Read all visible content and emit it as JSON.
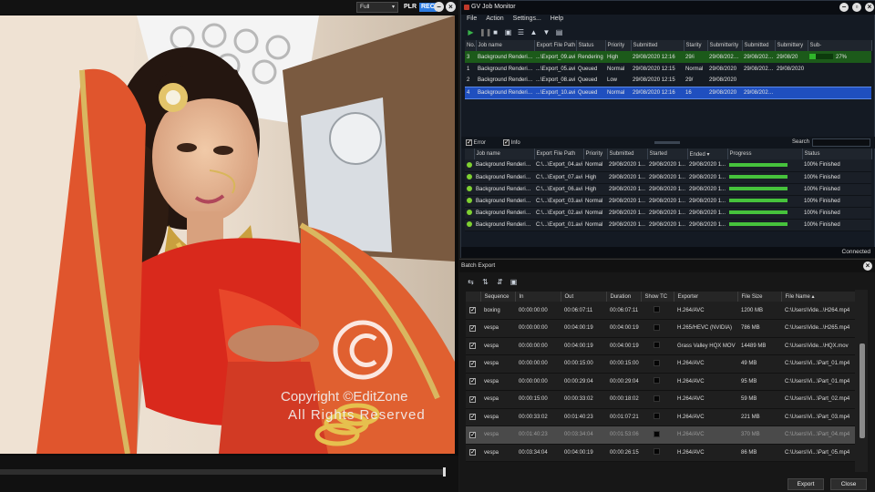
{
  "player": {
    "zoom_value": "Full",
    "plr_label": "PLR",
    "rec_label": "REC",
    "watermark_line1": "Copyright ©EditZone",
    "watermark_line2": "All Rights Reserved",
    "progress": 0.975
  },
  "job_monitor": {
    "title": "GV Job Monitor",
    "menu": [
      "File",
      "Action",
      "Settings...",
      "Help"
    ],
    "columns": [
      "No.",
      "Job name",
      "Export File Path",
      "Status",
      "Priority",
      "Submitted",
      "Starity",
      "Submitterity",
      "Submitted",
      "Submittery",
      "Sub-"
    ],
    "jobs": [
      {
        "no": "3",
        "name": "Background Rendering...",
        "path": "...\\Export_09.avi",
        "status": "Rendering",
        "priority": "High",
        "submitted": "29/08/2020 12:16",
        "c7": "29/i",
        "c8": "29/08/2020 ...",
        "c9": "29/08/2020 ...",
        "c10": "29/08/20",
        "c11": "",
        "pct": "27%",
        "progress": 0.27
      },
      {
        "no": "1",
        "name": "Background Rendering...",
        "path": "...\\Export_05.avi",
        "status": "Queued",
        "priority": "Normal",
        "submitted": "29/08/2020 12:15",
        "c7": "Normal",
        "c8": "29/08/2020",
        "c9": "29/08/2020 12:15",
        "c10": "29/08/2020",
        "c11": "",
        "pct": ""
      },
      {
        "no": "2",
        "name": "Background Rendering...",
        "path": "...\\Export_08.avi",
        "status": "Queued",
        "priority": "Low",
        "submitted": "29/08/2020 12:15",
        "c7": "29/",
        "c8": "29/08/2020",
        "c9": "",
        "c10": "",
        "c11": "",
        "pct": ""
      },
      {
        "no": "4",
        "name": "Background Rendering...",
        "path": "...\\Export_10.avi",
        "status": "Queued",
        "priority": "Normal",
        "submitted": "29/08/2020 12:16",
        "c7": "16",
        "c8": "29/08/2020",
        "c9": "29/08/2020 12:16",
        "c10": "",
        "c11": "",
        "pct": ""
      }
    ],
    "filters": {
      "error_label": "Error",
      "info_label": "Info",
      "search_label": "Search"
    },
    "history_columns": [
      "Job name",
      "Export File Path",
      "Priority",
      "Submitted",
      "Started",
      "Ended",
      "Progress",
      "Status"
    ],
    "history": [
      {
        "name": "Background Rendering...",
        "path": "C:\\...\\Export_04.avi",
        "priority": "Normal",
        "submitted": "29/08/2020 1...",
        "started": "29/08/2020 1...",
        "ended": "29/08/2020 1...",
        "progress": 1.0,
        "status": "100% Finished"
      },
      {
        "name": "Background Rendering...",
        "path": "C:\\...\\Export_07.avi",
        "priority": "High",
        "submitted": "29/08/2020 1...",
        "started": "29/08/2020 1...",
        "ended": "29/08/2020 1...",
        "progress": 1.0,
        "status": "100% Finished"
      },
      {
        "name": "Background Rendering...",
        "path": "C:\\...\\Export_06.avi",
        "priority": "High",
        "submitted": "29/08/2020 1...",
        "started": "29/08/2020 1...",
        "ended": "29/08/2020 1...",
        "progress": 1.0,
        "status": "100% Finished"
      },
      {
        "name": "Background Rendering...",
        "path": "C:\\...\\Export_03.avi",
        "priority": "Normal",
        "submitted": "29/08/2020 1...",
        "started": "29/08/2020 1...",
        "ended": "29/08/2020 1...",
        "progress": 1.0,
        "status": "100% Finished"
      },
      {
        "name": "Background Rendering...",
        "path": "C:\\...\\Export_02.avi",
        "priority": "Normal",
        "submitted": "29/08/2020 1...",
        "started": "29/08/2020 1...",
        "ended": "29/08/2020 1...",
        "progress": 1.0,
        "status": "100% Finished"
      },
      {
        "name": "Background Rendering...",
        "path": "C:\\...\\Export_01.avi",
        "priority": "Normal",
        "submitted": "29/08/2020 1...",
        "started": "29/08/2020 1...",
        "ended": "29/08/2020 1...",
        "progress": 1.0,
        "status": "100% Finished"
      }
    ],
    "connection_status": "Connected"
  },
  "batch_export": {
    "title": "Batch Export",
    "columns": [
      "Sequence",
      "In",
      "Out",
      "Duration",
      "Show TC",
      "Exporter",
      "File Size",
      "File Name"
    ],
    "rows": [
      {
        "checked": true,
        "sequence": "boxing",
        "in": "00:00:00:00",
        "out": "00:06:07:11",
        "duration": "00:06:07:11",
        "exporter": "H.264/AVC",
        "size": "1200 MB",
        "file": "C:\\Users\\Vide...\\H264.mp4",
        "selected": false
      },
      {
        "checked": true,
        "sequence": "vespa",
        "in": "00:00:00:00",
        "out": "00:04:00:19",
        "duration": "00:04:00:19",
        "exporter": "H.265/HEVC (NVIDIA)",
        "size": "786 MB",
        "file": "C:\\Users\\Vide...\\H265.mp4",
        "selected": false
      },
      {
        "checked": true,
        "sequence": "vespa",
        "in": "00:00:00:00",
        "out": "00:04:00:19",
        "duration": "00:04:00:19",
        "exporter": "Grass Valley HQX MOV",
        "size": "14489 MB",
        "file": "C:\\Users\\Vide...\\HQX.mov",
        "selected": false
      },
      {
        "checked": true,
        "sequence": "vespa",
        "in": "00:00:00:00",
        "out": "00:00:15:00",
        "duration": "00:00:15:00",
        "exporter": "H.264/AVC",
        "size": "49 MB",
        "file": "C:\\Users\\Vi...\\Part_01.mp4",
        "selected": false
      },
      {
        "checked": true,
        "sequence": "vespa",
        "in": "00:00:00:00",
        "out": "00:00:29:04",
        "duration": "00:00:29:04",
        "exporter": "H.264/AVC",
        "size": "95 MB",
        "file": "C:\\Users\\Vi...\\Part_01.mp4",
        "selected": false
      },
      {
        "checked": true,
        "sequence": "vespa",
        "in": "00:00:15:00",
        "out": "00:00:33:02",
        "duration": "00:00:18:02",
        "exporter": "H.264/AVC",
        "size": "59 MB",
        "file": "C:\\Users\\Vi...\\Part_02.mp4",
        "selected": false
      },
      {
        "checked": true,
        "sequence": "vespa",
        "in": "00:00:33:02",
        "out": "00:01:40:23",
        "duration": "00:01:07:21",
        "exporter": "H.264/AVC",
        "size": "221 MB",
        "file": "C:\\Users\\Vi...\\Part_03.mp4",
        "selected": false
      },
      {
        "checked": true,
        "sequence": "vespa",
        "in": "00:01:40:23",
        "out": "00:03:34:04",
        "duration": "00:01:53:06",
        "exporter": "H.264/AVC",
        "size": "370 MB",
        "file": "C:\\Users\\Vi...\\Part_04.mp4",
        "selected": true
      },
      {
        "checked": true,
        "sequence": "vespa",
        "in": "00:03:34:04",
        "out": "00:04:00:19",
        "duration": "00:00:26:15",
        "exporter": "H.264/AVC",
        "size": "86 MB",
        "file": "C:\\Users\\Vi...\\Part_05.mp4",
        "selected": false
      }
    ],
    "export_label": "Export",
    "close_label": "Close"
  },
  "icons": {
    "play": "play-icon",
    "pause": "pause-icon",
    "stop": "stop-icon",
    "delete": "delete-icon",
    "list": "list-icon",
    "up": "arrow-up-icon",
    "down": "arrow-down-icon",
    "briefcase": "briefcase-icon"
  },
  "colors": {
    "rendering_row": "#1c5a1a",
    "selected_row": "#1f4fbf",
    "progress_green": "#46c23c",
    "rec_badge": "#2d7be0"
  }
}
